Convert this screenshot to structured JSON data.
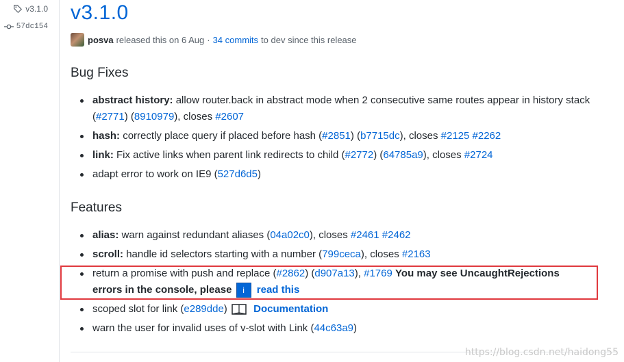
{
  "sidebar": {
    "tag": "v3.1.0",
    "commit": "57dc154"
  },
  "release": {
    "title": "v3.1.0",
    "author": "posva",
    "released_text": "released this on 6 Aug",
    "separator": "·",
    "commits_link": "34 commits",
    "commits_suffix": "to dev since this release"
  },
  "bug_fixes": {
    "heading": "Bug Fixes",
    "items": [
      {
        "label": "abstract history:",
        "text": "allow router.back in abstract mode when 2 consecutive same routes appear in history stack (",
        "ref1": "#2771",
        "mid": ") (",
        "ref2": "8910979",
        "closes": "), closes ",
        "issue1": "#2607"
      },
      {
        "label": "hash:",
        "text": "correctly place query if placed before hash (",
        "ref1": "#2851",
        "mid": ") (",
        "ref2": "b7715dc",
        "closes": "), closes ",
        "issue1": "#2125",
        "issue2": "#2262"
      },
      {
        "label": "link:",
        "text": "Fix active links when parent link redirects to child (",
        "ref1": "#2772",
        "mid": ") (",
        "ref2": "64785a9",
        "closes": "), closes ",
        "issue1": "#2724"
      },
      {
        "text": "adapt error to work on IE9 (",
        "ref1": "527d6d5",
        "end": ")"
      }
    ]
  },
  "features": {
    "heading": "Features",
    "items": [
      {
        "label": "alias:",
        "text": "warn against redundant aliases (",
        "ref1": "04a02c0",
        "closes": "), closes ",
        "issue1": "#2461",
        "issue2": "#2462"
      },
      {
        "label": "scroll:",
        "text": "handle id selectors starting with a number (",
        "ref1": "799ceca",
        "closes": "), closes ",
        "issue1": "#2163"
      },
      {
        "text": "return a promise with push and replace (",
        "ref1": "#2862",
        "mid": ") (",
        "ref2": "d907a13",
        "comma": "), ",
        "issue1": "#1769",
        "warning": "You may see UncaughtRejections errors in the console, please",
        "info_glyph": "i",
        "read_link": "read this"
      },
      {
        "text": "scoped slot for link (",
        "ref1": "e289dde",
        "end": ")",
        "doc_link": "Documentation"
      },
      {
        "text": "warn the user for invalid uses of v-slot with Link (",
        "ref1": "44c63a9",
        "end": ")"
      }
    ]
  },
  "watermark": "https://blog.csdn.net/haidong55",
  "colors": {
    "link": "#0366d6",
    "highlight_border": "#e0393e",
    "text": "#24292e",
    "muted": "#586069"
  }
}
